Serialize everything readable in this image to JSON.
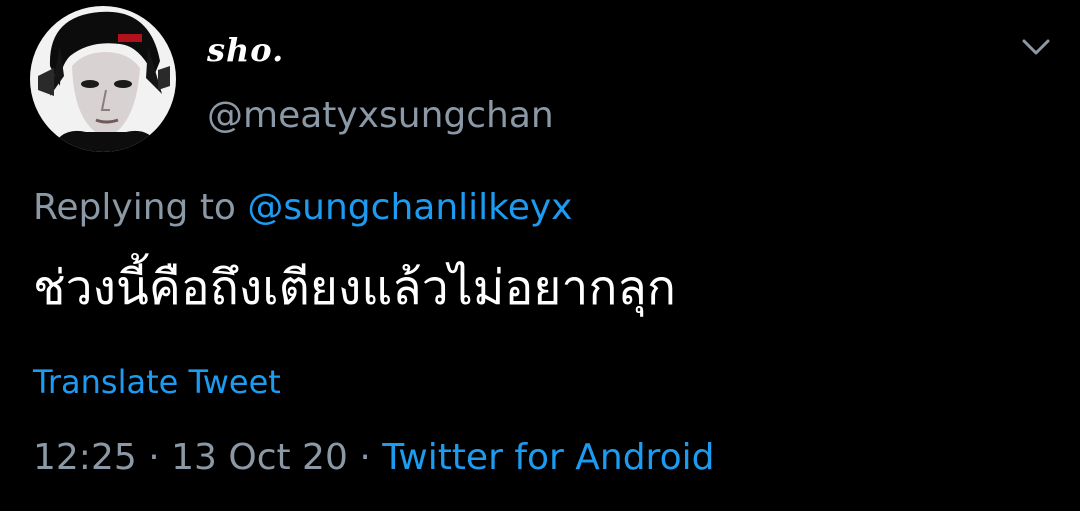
{
  "tweet": {
    "display_name": "sho.",
    "handle": "@meatyxsungchan",
    "reply": {
      "prefix": "Replying to",
      "mention": "@sungchanlilkeyx"
    },
    "text": "ช่วงนี้คือถึงเตียงแล้วไม่อยากลุก",
    "translate_label": "Translate Tweet",
    "time": "12:25",
    "separator": "·",
    "date": "13 Oct 20",
    "source": "Twitter for Android"
  },
  "icons": {
    "more": "chevron-down-icon",
    "avatar": "profile-avatar"
  },
  "colors": {
    "background": "#000000",
    "primary_text": "#ffffff",
    "secondary_text": "#8b98a5",
    "accent": "#1d9bf0"
  }
}
